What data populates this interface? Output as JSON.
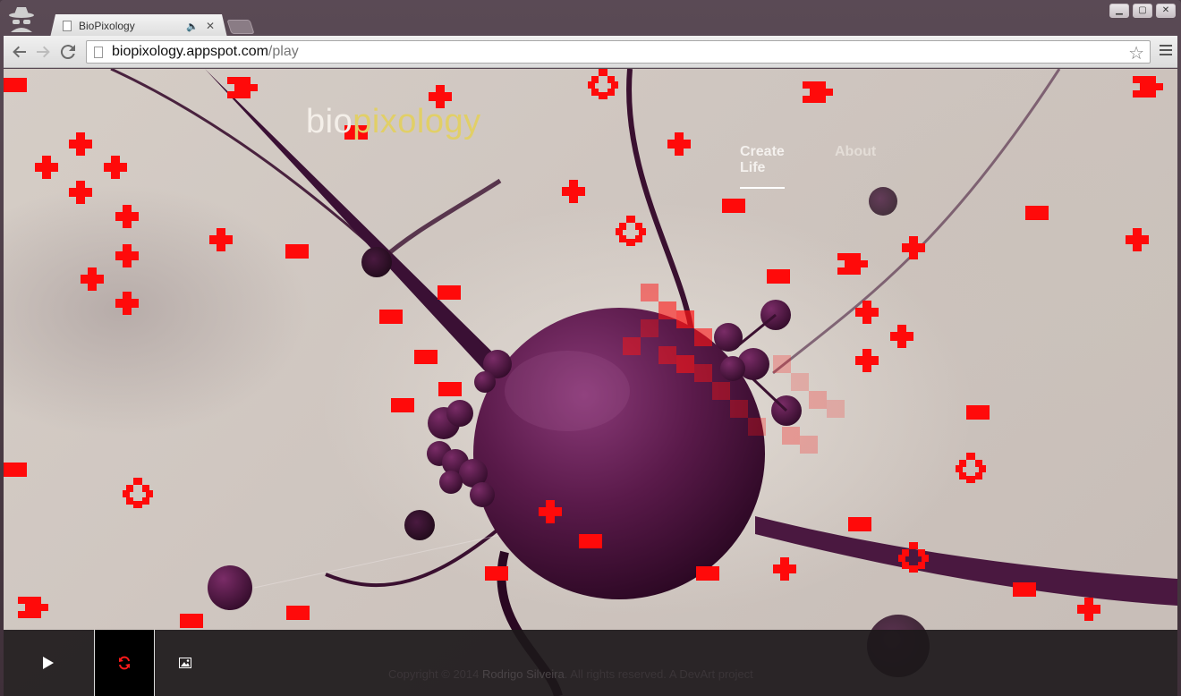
{
  "browser": {
    "tab_title": "BioPixology",
    "url_host": "biopixology.appspot.com",
    "url_path": "/play",
    "window_buttons": {
      "minimize": "▁",
      "maximize": "▢",
      "close": "✕"
    },
    "tab_close": "✕",
    "tab_audio": "🔈"
  },
  "site": {
    "logo_part1": "bio",
    "logo_part2": "pixology",
    "nav": [
      {
        "label": "Create Life",
        "active": true
      },
      {
        "label": "About",
        "active": false
      }
    ]
  },
  "footer": {
    "copyright": "Copyright © 2014 ",
    "author": "Rodrigo Silveira",
    "rights": ". All rights reserved. ",
    "project": "A DevArt project"
  },
  "controls": [
    {
      "name": "play",
      "icon": "play-icon"
    },
    {
      "name": "refresh",
      "icon": "refresh-icon"
    },
    {
      "name": "image",
      "icon": "image-icon"
    }
  ],
  "colors": {
    "pixel_red": "#ff0a0a",
    "logo_white": "#f4efe9",
    "logo_yellow": "#e1cf67",
    "cell_purple": "#5a1a4a"
  }
}
